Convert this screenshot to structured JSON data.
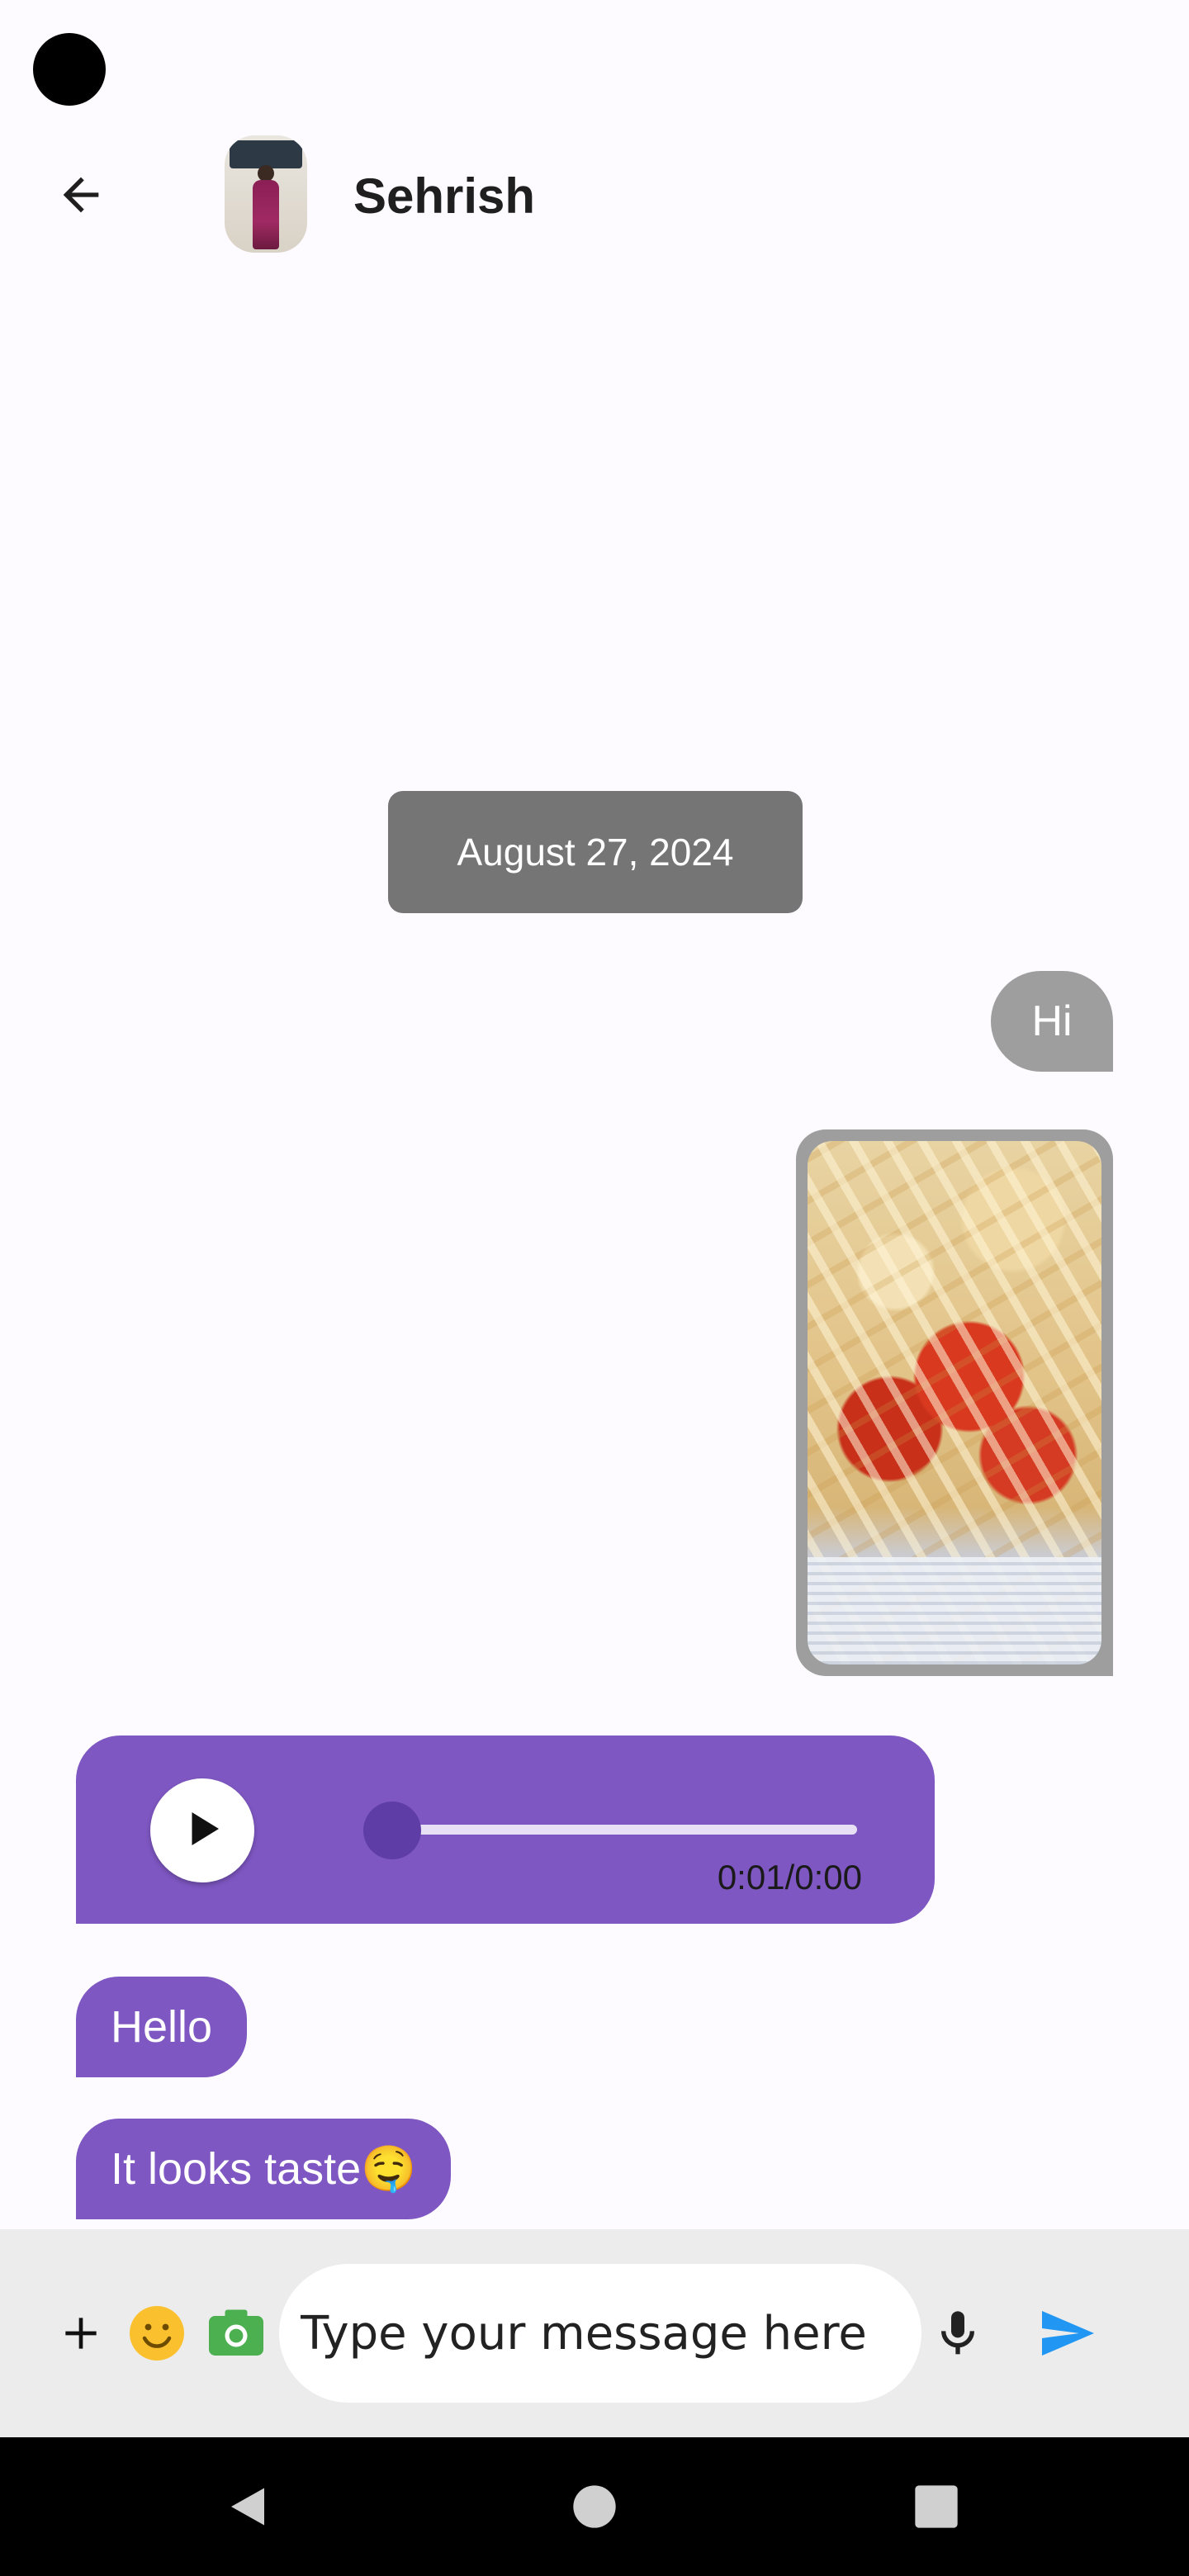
{
  "header": {
    "back_icon": "arrow-left-icon",
    "contact_name": "Sehrish",
    "avatar_alt": "contact-avatar"
  },
  "conversation": {
    "date_label": "August 27, 2024",
    "messages": [
      {
        "direction": "outgoing",
        "type": "text",
        "text": "Hi"
      },
      {
        "direction": "outgoing",
        "type": "image",
        "image_desc": "fries-with-ketchup-photo"
      },
      {
        "direction": "incoming",
        "type": "audio",
        "time_label": "0:01/0:00",
        "progress": 0.0
      },
      {
        "direction": "incoming",
        "type": "text",
        "text": "Hello"
      },
      {
        "direction": "incoming",
        "type": "text",
        "text": "It looks taste🤤"
      }
    ]
  },
  "composer": {
    "placeholder": "Type your message here",
    "icons": [
      "plus-icon",
      "emoji-icon",
      "camera-icon",
      "mic-icon",
      "send-icon"
    ]
  },
  "colors": {
    "incoming_bubble": "#7e57c2",
    "outgoing_bubble": "#9e9e9e",
    "date_chip": "#757575",
    "send_icon": "#2196f3",
    "camera_icon": "#4caf50",
    "emoji_icon": "#fbc02d"
  },
  "nav_bar": {
    "icons": [
      "back-triangle-icon",
      "home-circle-icon",
      "recents-square-icon"
    ]
  }
}
